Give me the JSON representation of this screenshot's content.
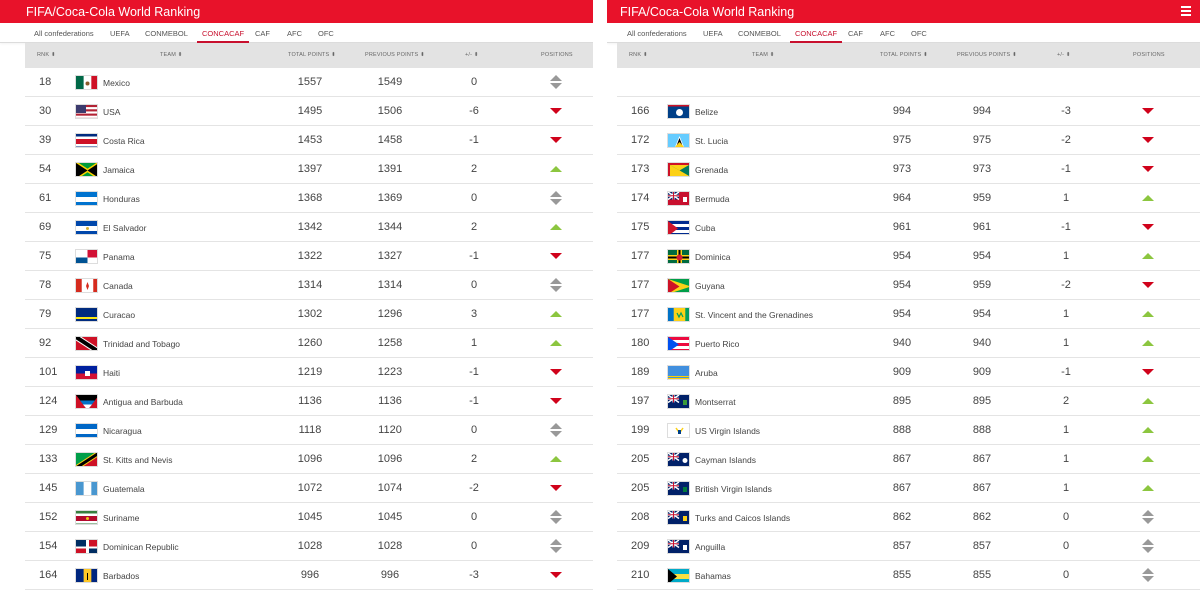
{
  "app_title": "FIFA/Coca-Cola World Ranking",
  "tabs": [
    "All confederations",
    "UEFA",
    "CONMEBOL",
    "CONCACAF",
    "CAF",
    "AFC",
    "OFC"
  ],
  "active_tab": "CONCACAF",
  "columns": {
    "rank": "RNK ⬍",
    "team": "TEAM ⬍",
    "total_points": "TOTAL POINTS ⬍",
    "previous_points": "PREVIOUS POINTS ⬍",
    "diff": "+/- ⬍",
    "positions": "POSITIONS"
  },
  "colors": {
    "brand_red": "#e8122a",
    "accent": "#c8102e",
    "up": "#8cc63f",
    "down": "#d0021b",
    "same": "#999999"
  },
  "left_rows": [
    {
      "rank": "18",
      "team": "Mexico",
      "flag": "mexico",
      "total": "1557",
      "prev": "1549",
      "diff": "0",
      "move": "same"
    },
    {
      "rank": "30",
      "team": "USA",
      "flag": "usa",
      "total": "1495",
      "prev": "1506",
      "diff": "-6",
      "move": "down"
    },
    {
      "rank": "39",
      "team": "Costa Rica",
      "flag": "costa-rica",
      "total": "1453",
      "prev": "1458",
      "diff": "-1",
      "move": "down"
    },
    {
      "rank": "54",
      "team": "Jamaica",
      "flag": "jamaica",
      "total": "1397",
      "prev": "1391",
      "diff": "2",
      "move": "up"
    },
    {
      "rank": "61",
      "team": "Honduras",
      "flag": "honduras",
      "total": "1368",
      "prev": "1369",
      "diff": "0",
      "move": "same"
    },
    {
      "rank": "69",
      "team": "El Salvador",
      "flag": "el-salvador",
      "total": "1342",
      "prev": "1344",
      "diff": "2",
      "move": "up"
    },
    {
      "rank": "75",
      "team": "Panama",
      "flag": "panama",
      "total": "1322",
      "prev": "1327",
      "diff": "-1",
      "move": "down"
    },
    {
      "rank": "78",
      "team": "Canada",
      "flag": "canada",
      "total": "1314",
      "prev": "1314",
      "diff": "0",
      "move": "same"
    },
    {
      "rank": "79",
      "team": "Curacao",
      "flag": "curacao",
      "total": "1302",
      "prev": "1296",
      "diff": "3",
      "move": "up"
    },
    {
      "rank": "92",
      "team": "Trinidad and Tobago",
      "flag": "trinidad",
      "total": "1260",
      "prev": "1258",
      "diff": "1",
      "move": "up"
    },
    {
      "rank": "101",
      "team": "Haiti",
      "flag": "haiti",
      "total": "1219",
      "prev": "1223",
      "diff": "-1",
      "move": "down"
    },
    {
      "rank": "124",
      "team": "Antigua and Barbuda",
      "flag": "antigua",
      "total": "1136",
      "prev": "1136",
      "diff": "-1",
      "move": "down"
    },
    {
      "rank": "129",
      "team": "Nicaragua",
      "flag": "nicaragua",
      "total": "1118",
      "prev": "1120",
      "diff": "0",
      "move": "same"
    },
    {
      "rank": "133",
      "team": "St. Kitts and Nevis",
      "flag": "st-kitts",
      "total": "1096",
      "prev": "1096",
      "diff": "2",
      "move": "up"
    },
    {
      "rank": "145",
      "team": "Guatemala",
      "flag": "guatemala",
      "total": "1072",
      "prev": "1074",
      "diff": "-2",
      "move": "down"
    },
    {
      "rank": "152",
      "team": "Suriname",
      "flag": "suriname",
      "total": "1045",
      "prev": "1045",
      "diff": "0",
      "move": "same"
    },
    {
      "rank": "154",
      "team": "Dominican Republic",
      "flag": "dominican",
      "total": "1028",
      "prev": "1028",
      "diff": "0",
      "move": "same"
    },
    {
      "rank": "164",
      "team": "Barbados",
      "flag": "barbados",
      "total": "996",
      "prev": "996",
      "diff": "-3",
      "move": "down"
    }
  ],
  "right_rows": [
    {
      "rank": "166",
      "team": "Belize",
      "flag": "belize",
      "total": "994",
      "prev": "994",
      "diff": "-3",
      "move": "down"
    },
    {
      "rank": "172",
      "team": "St. Lucia",
      "flag": "st-lucia",
      "total": "975",
      "prev": "975",
      "diff": "-2",
      "move": "down"
    },
    {
      "rank": "173",
      "team": "Grenada",
      "flag": "grenada",
      "total": "973",
      "prev": "973",
      "diff": "-1",
      "move": "down"
    },
    {
      "rank": "174",
      "team": "Bermuda",
      "flag": "bermuda",
      "total": "964",
      "prev": "959",
      "diff": "1",
      "move": "up"
    },
    {
      "rank": "175",
      "team": "Cuba",
      "flag": "cuba",
      "total": "961",
      "prev": "961",
      "diff": "-1",
      "move": "down"
    },
    {
      "rank": "177",
      "team": "Dominica",
      "flag": "dominica",
      "total": "954",
      "prev": "954",
      "diff": "1",
      "move": "up"
    },
    {
      "rank": "177",
      "team": "Guyana",
      "flag": "guyana",
      "total": "954",
      "prev": "959",
      "diff": "-2",
      "move": "down"
    },
    {
      "rank": "177",
      "team": "St. Vincent and the Grenadines",
      "flag": "st-vincent",
      "total": "954",
      "prev": "954",
      "diff": "1",
      "move": "up"
    },
    {
      "rank": "180",
      "team": "Puerto Rico",
      "flag": "puerto-rico",
      "total": "940",
      "prev": "940",
      "diff": "1",
      "move": "up"
    },
    {
      "rank": "189",
      "team": "Aruba",
      "flag": "aruba",
      "total": "909",
      "prev": "909",
      "diff": "-1",
      "move": "down"
    },
    {
      "rank": "197",
      "team": "Montserrat",
      "flag": "montserrat",
      "total": "895",
      "prev": "895",
      "diff": "2",
      "move": "up"
    },
    {
      "rank": "199",
      "team": "US Virgin Islands",
      "flag": "usvi",
      "total": "888",
      "prev": "888",
      "diff": "1",
      "move": "up"
    },
    {
      "rank": "205",
      "team": "Cayman Islands",
      "flag": "cayman",
      "total": "867",
      "prev": "867",
      "diff": "1",
      "move": "up"
    },
    {
      "rank": "205",
      "team": "British Virgin Islands",
      "flag": "bvi",
      "total": "867",
      "prev": "867",
      "diff": "1",
      "move": "up"
    },
    {
      "rank": "208",
      "team": "Turks and Caicos Islands",
      "flag": "turks-caicos",
      "total": "862",
      "prev": "862",
      "diff": "0",
      "move": "same"
    },
    {
      "rank": "209",
      "team": "Anguilla",
      "flag": "anguilla",
      "total": "857",
      "prev": "857",
      "diff": "0",
      "move": "same"
    },
    {
      "rank": "210",
      "team": "Bahamas",
      "flag": "bahamas",
      "total": "855",
      "prev": "855",
      "diff": "0",
      "move": "same"
    }
  ]
}
